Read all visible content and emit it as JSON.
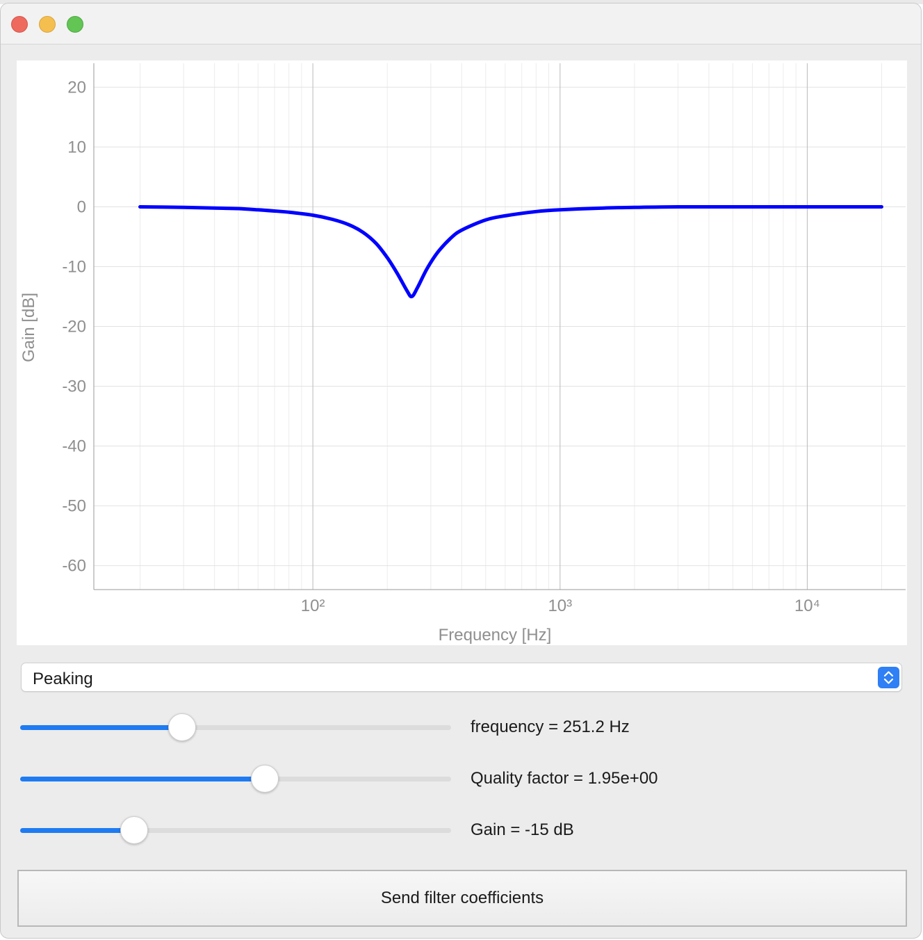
{
  "window": {
    "title": ""
  },
  "filter_type": {
    "selected": "Peaking"
  },
  "sliders": [
    {
      "name": "frequency",
      "label": "frequency = 251.2 Hz",
      "position": 0.375
    },
    {
      "name": "quality-factor",
      "label": "Quality factor = 1.95e+00",
      "position": 0.567
    },
    {
      "name": "gain",
      "label": "Gain = -15 dB",
      "position": 0.265
    }
  ],
  "send_button": {
    "label": "Send filter coefficients"
  },
  "chart_data": {
    "type": "line",
    "title": "",
    "xlabel": "Frequency [Hz]",
    "ylabel": "Gain [dB]",
    "x_scale": "log",
    "xlim": [
      13,
      25000
    ],
    "ylim": [
      -64,
      24
    ],
    "x_ticks": [
      {
        "value": 100,
        "label": "10²"
      },
      {
        "value": 1000,
        "label": "10³"
      },
      {
        "value": 10000,
        "label": "10⁴"
      }
    ],
    "y_ticks": [
      {
        "value": 20,
        "label": "20"
      },
      {
        "value": 10,
        "label": "10"
      },
      {
        "value": 0,
        "label": "0"
      },
      {
        "value": -10,
        "label": "-10"
      },
      {
        "value": -20,
        "label": "-20"
      },
      {
        "value": -30,
        "label": "-30"
      },
      {
        "value": -40,
        "label": "-40"
      },
      {
        "value": -50,
        "label": "-50"
      },
      {
        "value": -60,
        "label": "-60"
      }
    ],
    "grid": true,
    "line_color": "#0000ff",
    "series": [
      {
        "x": [
          20,
          30,
          40,
          50,
          60,
          70,
          80,
          100,
          120,
          140,
          160,
          180,
          200,
          220,
          240,
          251.2,
          265,
          290,
          320,
          360,
          400,
          500,
          600,
          800,
          1000,
          1500,
          2000,
          3000,
          5000,
          10000,
          20000
        ],
        "y": [
          0,
          -0.1,
          -0.2,
          -0.3,
          -0.5,
          -0.7,
          -0.9,
          -1.4,
          -2.1,
          -3,
          -4.3,
          -6.1,
          -8.5,
          -11.2,
          -14,
          -15,
          -13.5,
          -10.3,
          -7.6,
          -5.3,
          -3.9,
          -2.2,
          -1.5,
          -0.8,
          -0.5,
          -0.2,
          -0.1,
          0,
          0,
          0,
          0
        ]
      }
    ]
  }
}
